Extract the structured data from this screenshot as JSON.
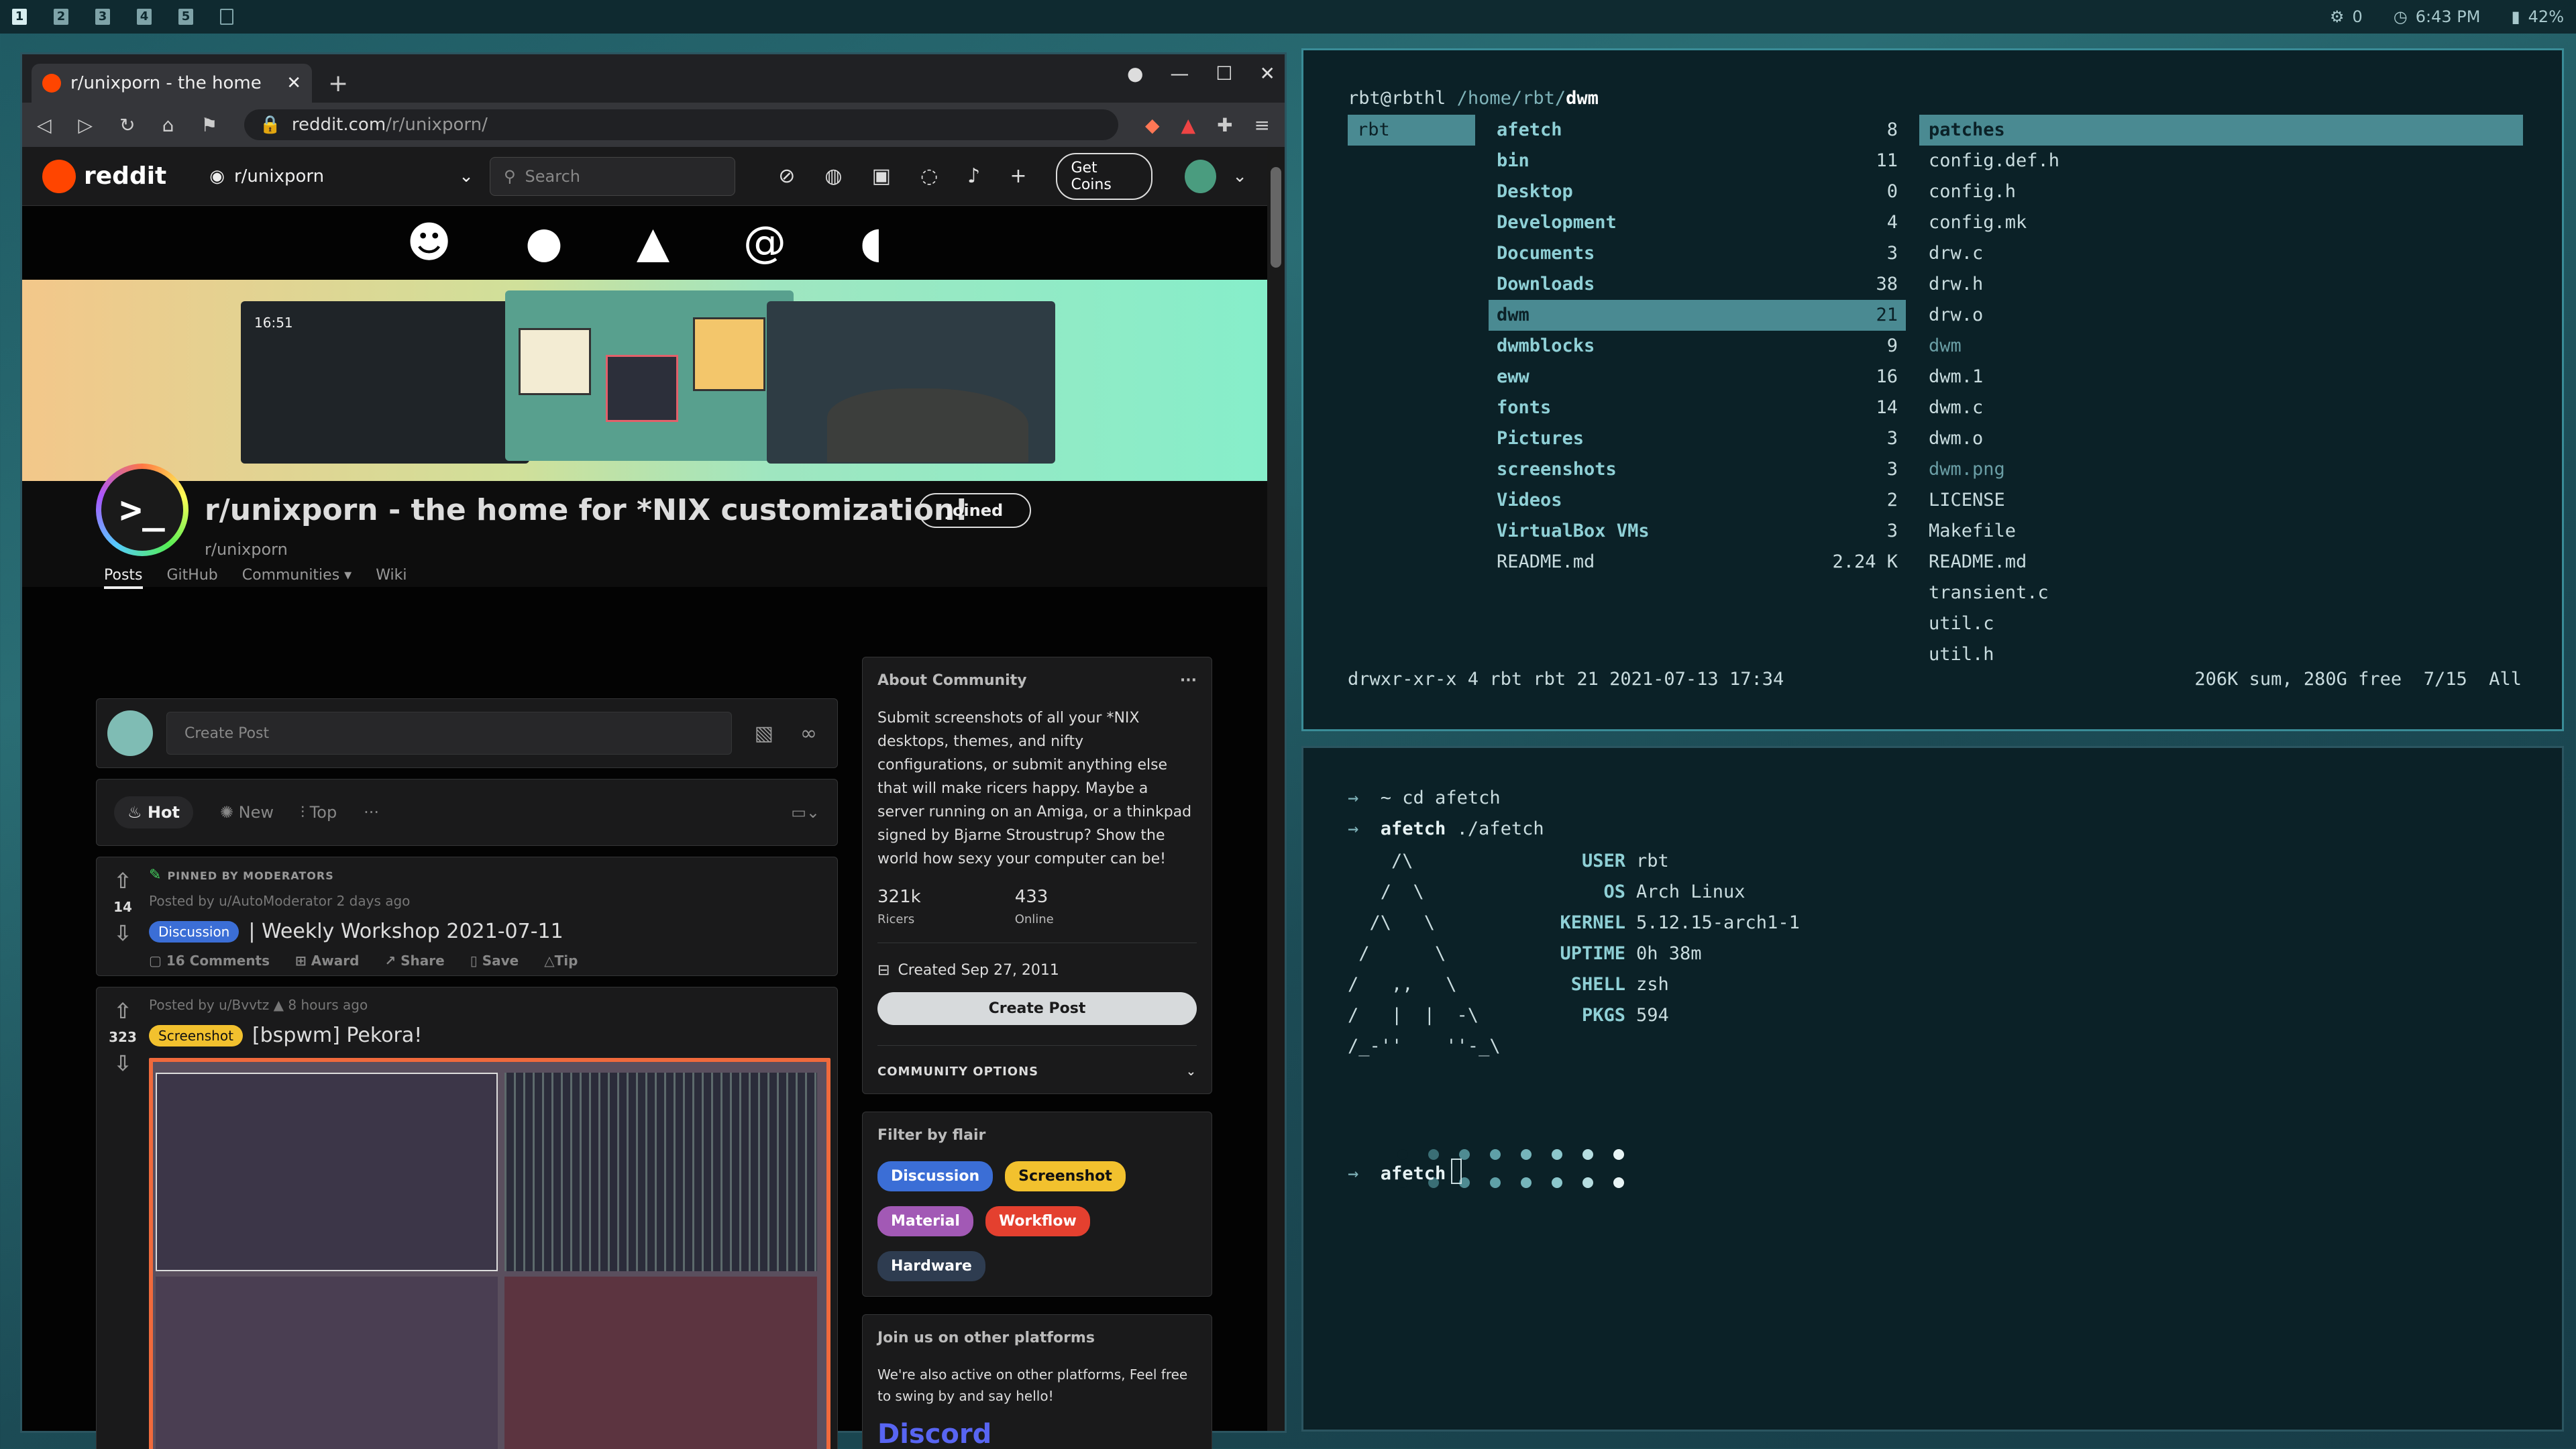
{
  "topbar": {
    "workspaces": [
      "1",
      "2",
      "3",
      "4",
      "5"
    ],
    "status": {
      "updates": "0",
      "time": "6:43 PM",
      "battery": "42%"
    }
  },
  "browser": {
    "tab_title": "r/unixporn - the home",
    "url_domain": "reddit.com",
    "url_path": "/r/unixporn/",
    "header": {
      "logo": "reddit",
      "community": "r/unixporn",
      "search_placeholder": "Search",
      "coins": "Get Coins"
    },
    "subreddit": {
      "title": "r/unixporn - the home for *NIX customization!",
      "name": "r/unixporn",
      "icon_glyph": ">_",
      "joined": "Joined",
      "nav": [
        "Posts",
        "GitHub",
        "Communities ▾",
        "Wiki"
      ]
    },
    "banner_clock": "16:51",
    "create_post_placeholder": "Create Post",
    "sort": {
      "hot": "Hot",
      "new": "New",
      "top": "Top"
    },
    "posts": [
      {
        "pinned_label": "PINNED BY MODERATORS",
        "votes": "14",
        "meta": "Posted by u/AutoModerator 2 days ago",
        "flair": "Discussion",
        "title": "| Weekly Workshop 2021-07-11",
        "actions": [
          "16 Comments",
          "Award",
          "Share",
          "Save",
          "Tip"
        ]
      },
      {
        "votes": "323",
        "meta": "Posted by u/Bvvtz",
        "time": "8 hours ago",
        "flair": "Screenshot",
        "title": "[bspwm] Pekora!"
      }
    ],
    "about": {
      "heading": "About Community",
      "text": "Submit screenshots of all your *NIX desktops, themes, and nifty configurations, or submit anything else that will make ricers happy. Maybe a server running on an Amiga, or a thinkpad signed by Bjarne Stroustrup? Show the world how sexy your computer can be!",
      "members": "321k",
      "members_label": "Ricers",
      "online": "433",
      "online_label": "Online",
      "created": "Created Sep 27, 2011",
      "create_post": "Create Post",
      "community_options": "COMMUNITY OPTIONS"
    },
    "filter": {
      "heading": "Filter by flair",
      "flairs": [
        "Discussion",
        "Screenshot",
        "Material",
        "Workflow",
        "Hardware"
      ]
    },
    "platforms": {
      "heading": "Join us on other platforms",
      "text": "We're also active on other platforms, Feel free to swing by and say hello!",
      "discord": "Discord"
    }
  },
  "files": {
    "user_host": "rbt@rbthl",
    "path": "/home/rbt/",
    "dir": "dwm",
    "parent": [
      "rbt"
    ],
    "current": [
      {
        "name": "afetch",
        "size": "8"
      },
      {
        "name": "bin",
        "size": "11"
      },
      {
        "name": "Desktop",
        "size": "0"
      },
      {
        "name": "Development",
        "size": "4"
      },
      {
        "name": "Documents",
        "size": "3"
      },
      {
        "name": "Downloads",
        "size": "38"
      },
      {
        "name": "dwm",
        "size": "21"
      },
      {
        "name": "dwmblocks",
        "size": "9"
      },
      {
        "name": "eww",
        "size": "16"
      },
      {
        "name": "fonts",
        "size": "14"
      },
      {
        "name": "Pictures",
        "size": "3"
      },
      {
        "name": "screenshots",
        "size": "3"
      },
      {
        "name": "Videos",
        "size": "2"
      },
      {
        "name": "VirtualBox VMs",
        "size": "3"
      },
      {
        "name": "README.md",
        "size": "2.24 K"
      }
    ],
    "preview": [
      "patches",
      "config.def.h",
      "config.h",
      "config.mk",
      "drw.c",
      "drw.h",
      "drw.o",
      "dwm",
      "dwm.1",
      "dwm.c",
      "dwm.o",
      "dwm.png",
      "LICENSE",
      "Makefile",
      "README.md",
      "transient.c",
      "util.c",
      "util.h"
    ],
    "status_left": "drwxr-xr-x 4 rbt rbt 21 2021-07-13 17:34",
    "status_right": "206K sum, 280G free  7/15  All"
  },
  "terminal": {
    "prompt": "→",
    "cmd1": "~ cd afetch",
    "cmd2_dir": "afetch",
    "cmd2": "./afetch",
    "ascii": "    /\\\n   /  \\\n  /\\   \\\n /      \\\n/   ,,   \\\n/   |  |  -\\\n/_-''    ''-_\\",
    "info": [
      {
        "k": "USER",
        "v": "rbt"
      },
      {
        "k": "OS",
        "v": "Arch Linux"
      },
      {
        "k": "KERNEL",
        "v": "5.12.15-arch1-1"
      },
      {
        "k": "UPTIME",
        "v": "0h 38m"
      },
      {
        "k": "SHELL",
        "v": "zsh"
      },
      {
        "k": "PKGS",
        "v": "594"
      }
    ],
    "palette": [
      "#0b2127",
      "#3a6e75",
      "#4f8b92",
      "#5fa0a7",
      "#76b5bb",
      "#8cc7cc",
      "#b6dde0",
      "#e8f4f5"
    ],
    "last_dir": "afetch"
  }
}
